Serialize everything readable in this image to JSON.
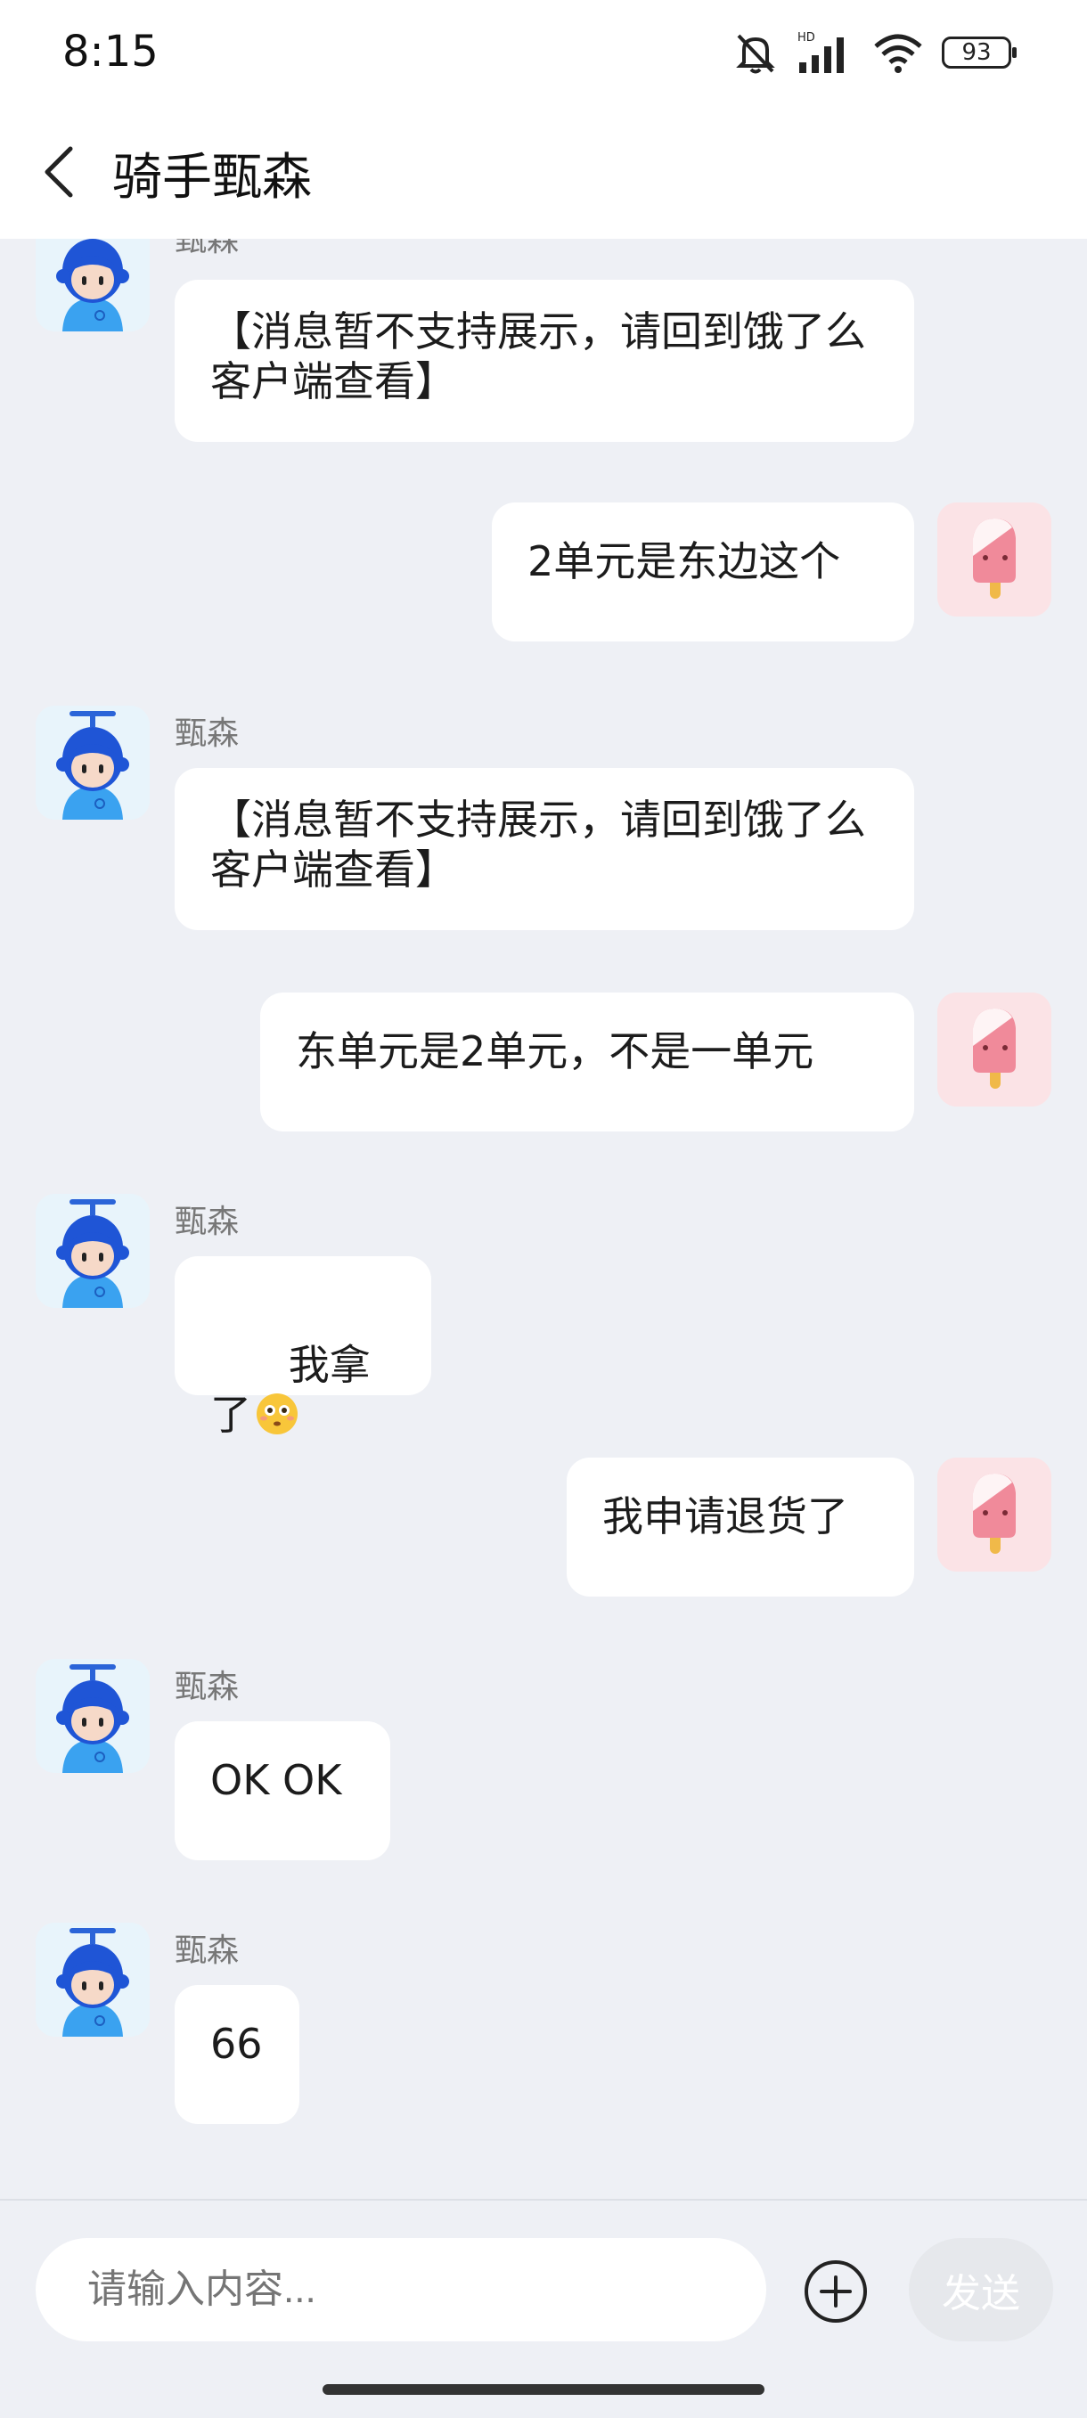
{
  "status_bar": {
    "time": "8:15",
    "network": "HD",
    "battery": "93",
    "icons": [
      "mute-bell-icon",
      "signal-icon",
      "wifi-icon",
      "battery-icon"
    ]
  },
  "header": {
    "title": "骑手甄森",
    "back_icon": "chevron-left-icon"
  },
  "messages": [
    {
      "from": "rider",
      "sender": "甄森",
      "text": "【消息暂不支持展示，请回到饿了么\n客户端查看】"
    },
    {
      "from": "me",
      "text": "2单元是东边这个"
    },
    {
      "from": "rider",
      "sender": "甄森",
      "text": "【消息暂不支持展示，请回到饿了么\n客户端查看】"
    },
    {
      "from": "me",
      "text": "东单元是2单元，不是一单元"
    },
    {
      "from": "rider",
      "sender": "甄森",
      "text": "我拿了",
      "emoji": "flushed-face-emoji"
    },
    {
      "from": "me",
      "text": "我申请退货了"
    },
    {
      "from": "rider",
      "sender": "甄森",
      "text": "OK OK"
    },
    {
      "from": "rider",
      "sender": "甄森",
      "text": "66"
    }
  ],
  "composer": {
    "placeholder": "请输入内容...",
    "plus_icon": "plus-circle-icon",
    "send_label": "发送"
  },
  "colors": {
    "background": "#eef0f5",
    "bubble": "#ffffff",
    "send_disabled": "#e6e8ec"
  }
}
